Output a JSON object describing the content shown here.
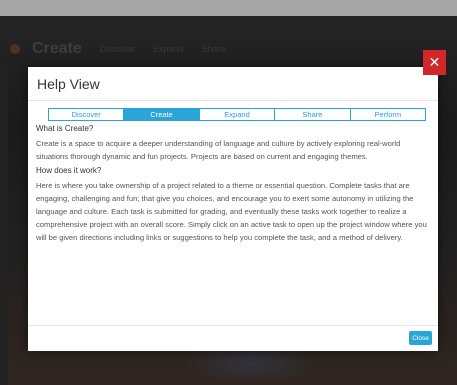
{
  "background": {
    "app_title": "Create",
    "nav_items": [
      "Discover",
      "Expand",
      "Share"
    ]
  },
  "modal": {
    "title": "Help View",
    "close_icon": "✕",
    "tabs": [
      {
        "label": "Discover",
        "active": false
      },
      {
        "label": "Create",
        "active": true
      },
      {
        "label": "Expand",
        "active": false
      },
      {
        "label": "Share",
        "active": false
      },
      {
        "label": "Perform",
        "active": false
      }
    ],
    "sections": [
      {
        "heading": "What is Create?",
        "text": "Create is a space to acquire a deeper understanding of language and culture by actively exploring real-world situations thorough dynamic and fun projects. Projects are based on current and engaging themes."
      },
      {
        "heading": "How does it work?",
        "text": "Here is where you take ownership of a project related to a theme or essential question. Complete tasks that are engaging, challenging and fun; that give you choices, and encourage you to exert some autonomy in utilizing the language and culture. Each task is submitted for grading, and eventually these tasks work together to realize a comprehensive project with an overall score. Simply click on an active task to open up the project window where you will be given directions including links or suggestions to help you complete the task, and a method of delivery."
      }
    ],
    "close_button": "Close"
  },
  "colors": {
    "accent": "#2aa5d8",
    "close_red": "#d1272a"
  }
}
